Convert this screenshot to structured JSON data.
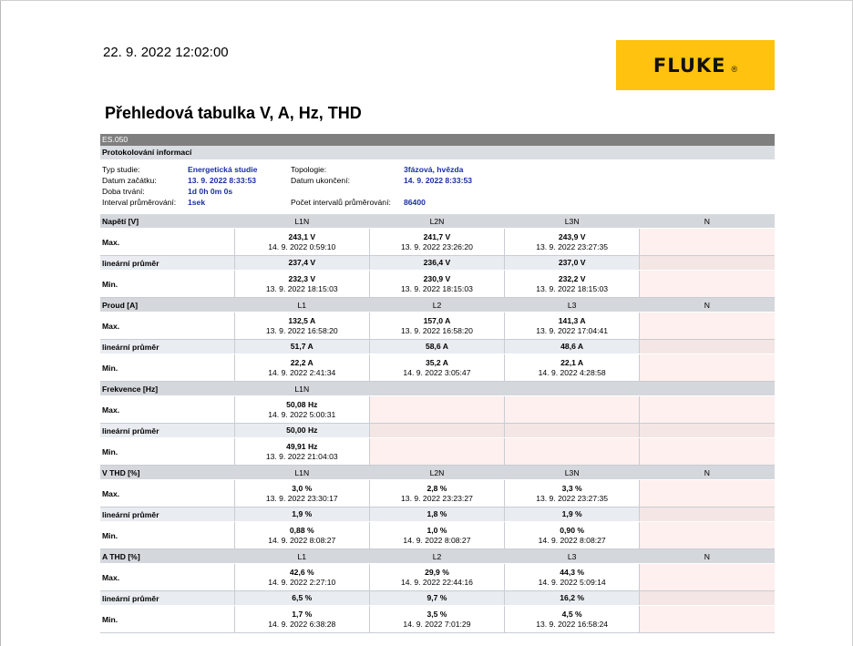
{
  "header": {
    "datetime": "22. 9. 2022 12:02:00",
    "logo_text": "FLUKE",
    "logo_reg": "®",
    "title": "Přehledová tabulka V, A, Hz, THD"
  },
  "report_id": "ES.050",
  "protocol": {
    "heading": "Protokolování informací",
    "rows": [
      {
        "l1": "Typ studie:",
        "v1": "Energetická studie",
        "l2": "Topologie:",
        "v2": "3fázová, hvězda"
      },
      {
        "l1": "Datum začátku:",
        "v1": "13. 9. 2022 8:33:53",
        "l2": "Datum ukončení:",
        "v2": "14. 9. 2022 8:33:53"
      },
      {
        "l1": "Doba trvání:",
        "v1": "1d 0h 0m 0s",
        "l2": "",
        "v2": ""
      },
      {
        "l1": "Interval průměrování:",
        "v1": "1sek",
        "l2": "Počet intervalů průměrování:",
        "v2": "86400"
      }
    ]
  },
  "labels": {
    "max": "Max.",
    "avg": "lineární průměr",
    "min": "Min."
  },
  "sections": [
    {
      "name": "Napětí [V]",
      "cols": [
        "L1N",
        "L2N",
        "L3N",
        "N"
      ],
      "max": [
        {
          "v": "243,1 V",
          "t": "14. 9. 2022 0:59:10"
        },
        {
          "v": "241,7 V",
          "t": "13. 9. 2022 23:26:20"
        },
        {
          "v": "243,9 V",
          "t": "13. 9. 2022 23:27:35"
        },
        null
      ],
      "avg": [
        "237,4 V",
        "236,4 V",
        "237,0 V",
        null
      ],
      "min": [
        {
          "v": "232,3 V",
          "t": "13. 9. 2022 18:15:03"
        },
        {
          "v": "230,9 V",
          "t": "13. 9. 2022 18:15:03"
        },
        {
          "v": "232,2 V",
          "t": "13. 9. 2022 18:15:03"
        },
        null
      ]
    },
    {
      "name": "Proud [A]",
      "cols": [
        "L1",
        "L2",
        "L3",
        "N"
      ],
      "max": [
        {
          "v": "132,5 A",
          "t": "13. 9. 2022 16:58:20"
        },
        {
          "v": "157,0 A",
          "t": "13. 9. 2022 16:58:20"
        },
        {
          "v": "141,3 A",
          "t": "13. 9. 2022 17:04:41"
        },
        null
      ],
      "avg": [
        "51,7 A",
        "58,6 A",
        "48,6 A",
        null
      ],
      "min": [
        {
          "v": "22,2 A",
          "t": "14. 9. 2022 2:41:34"
        },
        {
          "v": "35,2 A",
          "t": "14. 9. 2022 3:05:47"
        },
        {
          "v": "22,1 A",
          "t": "14. 9. 2022 4:28:58"
        },
        null
      ]
    },
    {
      "name": "Frekvence [Hz]",
      "cols": [
        "L1N",
        "",
        "",
        ""
      ],
      "max": [
        {
          "v": "50,08 Hz",
          "t": "14. 9. 2022 5:00:31"
        },
        null,
        null,
        null
      ],
      "avg": [
        "50,00 Hz",
        null,
        null,
        null
      ],
      "min": [
        {
          "v": "49,91 Hz",
          "t": "13. 9. 2022 21:04:03"
        },
        null,
        null,
        null
      ]
    },
    {
      "name": "V THD [%]",
      "cols": [
        "L1N",
        "L2N",
        "L3N",
        "N"
      ],
      "max": [
        {
          "v": "3,0 %",
          "t": "13. 9. 2022 23:30:17"
        },
        {
          "v": "2,8 %",
          "t": "13. 9. 2022 23:23:27"
        },
        {
          "v": "3,3 %",
          "t": "13. 9. 2022 23:27:35"
        },
        null
      ],
      "avg": [
        "1,9 %",
        "1,8 %",
        "1,9 %",
        null
      ],
      "min": [
        {
          "v": "0,88 %",
          "t": "14. 9. 2022 8:08:27"
        },
        {
          "v": "1,0 %",
          "t": "14. 9. 2022 8:08:27"
        },
        {
          "v": "0,90 %",
          "t": "14. 9. 2022 8:08:27"
        },
        null
      ]
    },
    {
      "name": "A THD [%]",
      "cols": [
        "L1",
        "L2",
        "L3",
        "N"
      ],
      "max": [
        {
          "v": "42,6 %",
          "t": "14. 9. 2022 2:27:10"
        },
        {
          "v": "29,9 %",
          "t": "14. 9. 2022 22:44:16"
        },
        {
          "v": "44,3 %",
          "t": "14. 9. 2022 5:09:14"
        },
        null
      ],
      "avg": [
        "6,5 %",
        "9,7 %",
        "16,2 %",
        null
      ],
      "min": [
        {
          "v": "1,7 %",
          "t": "14. 9. 2022 6:38:28"
        },
        {
          "v": "3,5 %",
          "t": "14. 9. 2022 7:01:29"
        },
        {
          "v": "4,5 %",
          "t": "13. 9. 2022 16:58:24"
        },
        null
      ]
    }
  ]
}
